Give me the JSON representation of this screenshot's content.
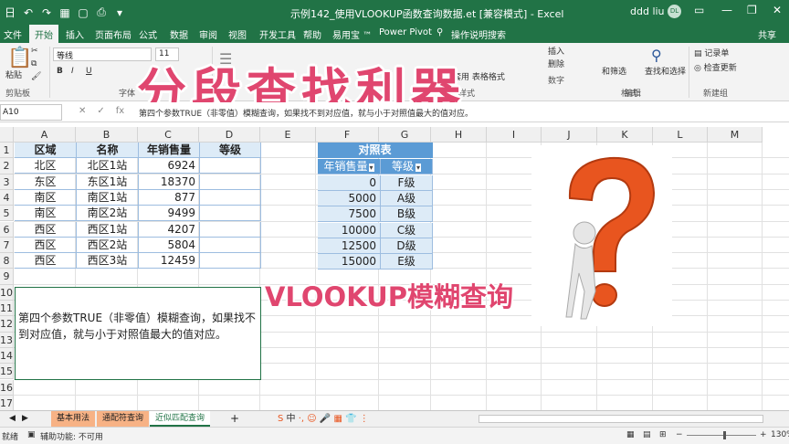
{
  "titlebar": {
    "save_label": "日",
    "doc_title": "示例142_使用VLOOKUP函数查询数据.et  [兼容模式]  -  Excel",
    "user_name": "ddd liu",
    "avatar_initials": "DL",
    "minimize": "—",
    "restore": "❐",
    "close": "✕"
  },
  "tabs": {
    "items": [
      "文件",
      "开始",
      "插入",
      "页面布局",
      "公式",
      "数据",
      "审阅",
      "视图",
      "开发工具",
      "帮助",
      "易用宝 ™",
      "Power Pivot",
      "操作说明搜索"
    ],
    "active_index": 1,
    "share_label": "共享"
  },
  "ribbon": {
    "paste_label": "粘贴",
    "clipboard_label": "剪贴板",
    "font_name": "等线",
    "font_size": "11",
    "bold": "B",
    "italic": "I",
    "underline": "U",
    "font_group_label": "字体",
    "style_group_label": "样式",
    "apply_table_label": "套用\n表格格式",
    "insert_label": "插入",
    "delete_label": "删除",
    "filter_label": "和筛选",
    "find_label": "查找和选择",
    "edit_group_label": "编辑",
    "record_label": "记录单",
    "check_update_label": "检查更新",
    "new_group_label": "新建组",
    "number_label": "数字",
    "format_label": "格式"
  },
  "overlay": {
    "big_title": "分段查找利器",
    "caption": "VLOOKUP模糊查询"
  },
  "formula_bar": {
    "name_box": "A10",
    "cancel": "✕",
    "confirm": "✓",
    "fx": "fx",
    "formula_text": "第四个参数TRUE（非零值）模糊查询，如果找不到对应值，就与小于对照值最大的值对应。"
  },
  "columns": [
    "A",
    "B",
    "C",
    "D",
    "E",
    "F",
    "G",
    "H",
    "I",
    "J",
    "K",
    "L",
    "M"
  ],
  "rows": [
    "1",
    "2",
    "3",
    "4",
    "5",
    "6",
    "7",
    "8",
    "9",
    "10",
    "11",
    "12",
    "13",
    "14",
    "15",
    "16",
    "17"
  ],
  "main_table": {
    "headers": [
      "区域",
      "名称",
      "年销售量",
      "等级"
    ],
    "rows": [
      [
        "北区",
        "北区1站",
        "6924",
        ""
      ],
      [
        "东区",
        "东区1站",
        "18370",
        ""
      ],
      [
        "南区",
        "南区1站",
        "877",
        ""
      ],
      [
        "南区",
        "南区2站",
        "9499",
        ""
      ],
      [
        "西区",
        "西区1站",
        "4207",
        ""
      ],
      [
        "西区",
        "西区2站",
        "5804",
        ""
      ],
      [
        "西区",
        "西区3站",
        "12459",
        ""
      ]
    ]
  },
  "lookup_table": {
    "title": "对照表",
    "headers": [
      "年销售量",
      "等级"
    ],
    "rows": [
      [
        "0",
        "F级"
      ],
      [
        "5000",
        "A级"
      ],
      [
        "7500",
        "B级"
      ],
      [
        "10000",
        "C级"
      ],
      [
        "12500",
        "D级"
      ],
      [
        "15000",
        "E级"
      ]
    ]
  },
  "note_text": "第四个参数TRUE（非零值）模糊查询，如果找不到对应值，就与小于对照值最大的值对应。",
  "sheet_tabs": {
    "items": [
      "基本用法",
      "通配符查询",
      "近似匹配查询"
    ],
    "active_index": 2,
    "add": "+"
  },
  "status_bar": {
    "mode": "就绪",
    "accessibility": "辅助功能: 不可用",
    "zoom": "130%",
    "ime": "中"
  },
  "colors": {
    "excel_green": "#217346",
    "overlay_pink": "#e0466f",
    "table_header_blue": "#5b9bd5",
    "row_fill": "#ddebf7",
    "other_tab_orange": "#f7b285"
  }
}
